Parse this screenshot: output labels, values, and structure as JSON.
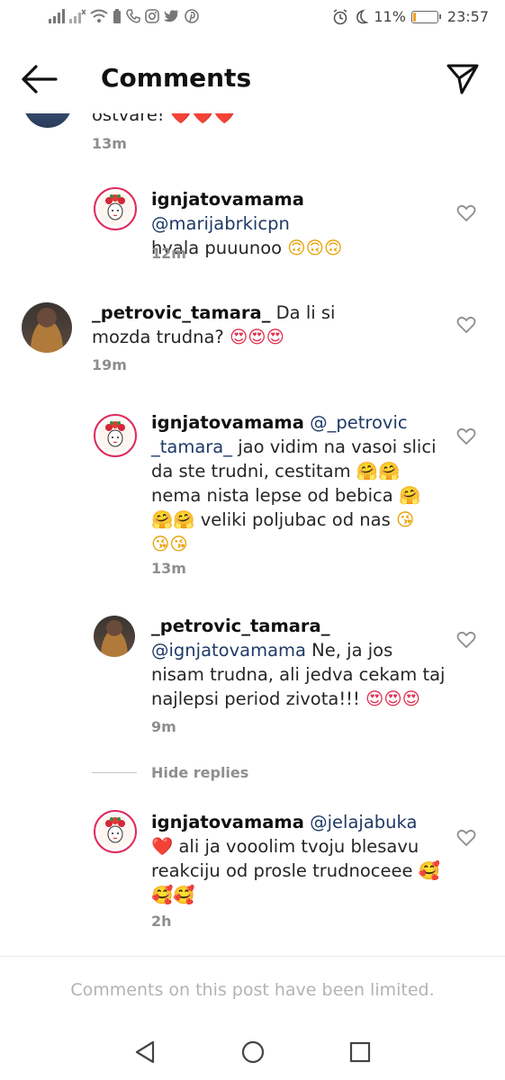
{
  "status_bar": {
    "battery_percent_text": "11%",
    "battery_level": 0.11,
    "time": "23:57"
  },
  "header": {
    "title": "Comments",
    "back_icon": "arrow-left-icon",
    "send_icon": "paper-plane-icon"
  },
  "comments": [
    {
      "id": "c0",
      "username": "",
      "text_partial": "ostvare! ",
      "emojis": "❤️❤️❤️",
      "time": "13m"
    },
    {
      "id": "r1",
      "username": "ignjatovamama",
      "mention": "@marijabrkicpn",
      "text": "hvala puuunoo ",
      "emojis": "🙃🙃🙃",
      "time": "12m"
    },
    {
      "id": "c2",
      "username": "_petrovic_tamara_",
      "text": " Da li si mozda trudna? ",
      "emojis": "😍😍😍",
      "time": "19m"
    },
    {
      "id": "r3",
      "username": "ignjatovamama",
      "mention": "@_petrovic",
      "mention2": "_tamara_",
      "text_line1": " jao vidim na vasoi slici",
      "text_line2": "da ste trudni, cestitam ",
      "emojis_line2": "🤗🤗",
      "text_line3": "nema nista lepse od bebica ",
      "emojis_line3": "🤗",
      "emojis_line4a": "🤗🤗",
      "text_line4": " veliki poljubac od nas ",
      "emojis_line4b": "😘",
      "emojis_line5": "😘😘",
      "time": "13m"
    },
    {
      "id": "r4",
      "username": "_petrovic_tamara_",
      "mention": "@ignjatovamama",
      "text_line1": " Ne, ja jos",
      "text_line2": "nisam trudna, ali jedva cekam taj",
      "text_line3": "najlepsi period zivota!!! ",
      "emojis_line3": "😍😍😍",
      "time": "9m"
    },
    {
      "id": "r5",
      "username": "ignjatovamama",
      "mention": "@jelajabuka",
      "emoji_start": "❤️",
      "text_line1": " ali ja vooolim tvoju blesavu",
      "text_line2": "reakciju od prosle trudnoceee ",
      "emojis_line2": "🥰",
      "emojis_line3": "🥰🥰",
      "time": "2h"
    }
  ],
  "hide_replies_label": "Hide replies",
  "limited_notice": "Comments on this post have been limited.",
  "colors": {
    "mention": "#1f3a66",
    "meta": "#8e8e8e",
    "story_ring": "#e02a5a"
  }
}
